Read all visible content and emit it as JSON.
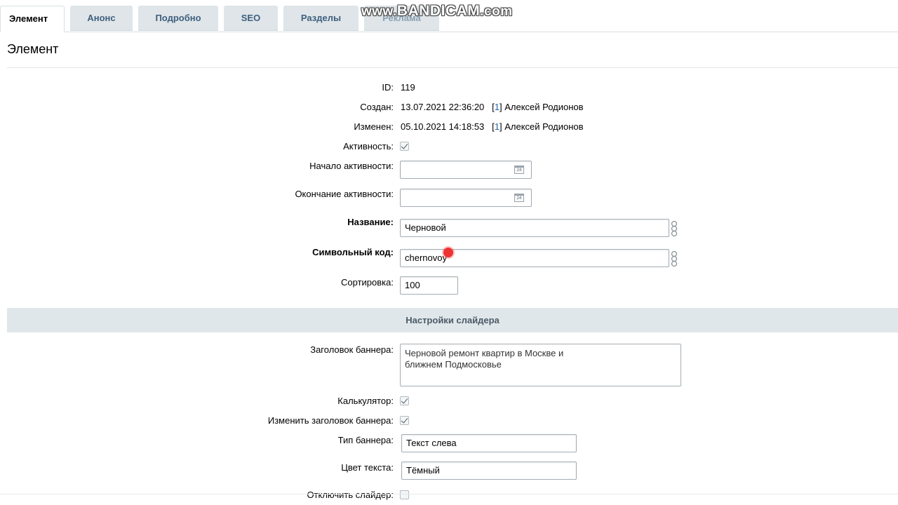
{
  "tabs": [
    {
      "label": "Элемент",
      "active": true
    },
    {
      "label": "Анонс"
    },
    {
      "label": "Подробно"
    },
    {
      "label": "SEO"
    },
    {
      "label": "Разделы"
    },
    {
      "label": "Реклама"
    }
  ],
  "watermark": {
    "prefix": "www.",
    "brand": "BANDICAM",
    "suffix": ".com"
  },
  "page_title": "Элемент",
  "fields": {
    "id": {
      "label": "ID:",
      "value": "119"
    },
    "created": {
      "label": "Создан:",
      "value": "13.07.2021 22:36:20",
      "user_id": "1",
      "user_name": "Алексей Родионов"
    },
    "modified": {
      "label": "Изменен:",
      "value": "05.10.2021 14:18:53",
      "user_id": "1",
      "user_name": "Алексей Родионов"
    },
    "active": {
      "label": "Активность:",
      "checked": true
    },
    "active_from": {
      "label": "Начало активности:",
      "value": ""
    },
    "active_to": {
      "label": "Окончание активности:",
      "value": ""
    },
    "name": {
      "label": "Название:",
      "value": "Черновой"
    },
    "code": {
      "label": "Символьный код:",
      "value": "chernovoy"
    },
    "sort": {
      "label": "Сортировка:",
      "value": "100"
    }
  },
  "section": {
    "title": "Настройки слайдера"
  },
  "slider": {
    "banner_title": {
      "label": "Заголовок баннера:",
      "value": "Черновой ремонт квартир в Москве и\nближнем Подмосковье"
    },
    "calculator": {
      "label": "Калькулятор:",
      "checked": true
    },
    "change_banner_title": {
      "label": "Изменить заголовок баннера:",
      "checked": true
    },
    "banner_type": {
      "label": "Тип баннера:",
      "value": "Текст слева"
    },
    "text_color": {
      "label": "Цвет текста:",
      "value": "Тёмный"
    },
    "disable_slider": {
      "label": "Отключить слайдер:",
      "checked": false
    }
  },
  "icons": {
    "calendar": "calendar-icon",
    "translit": "translit-settings-icon"
  },
  "colors": {
    "tab_bg": "#dfe5e8",
    "tab_text": "#3f5f7f",
    "section_bg": "#e0e7ea",
    "link": "#2067b0"
  }
}
